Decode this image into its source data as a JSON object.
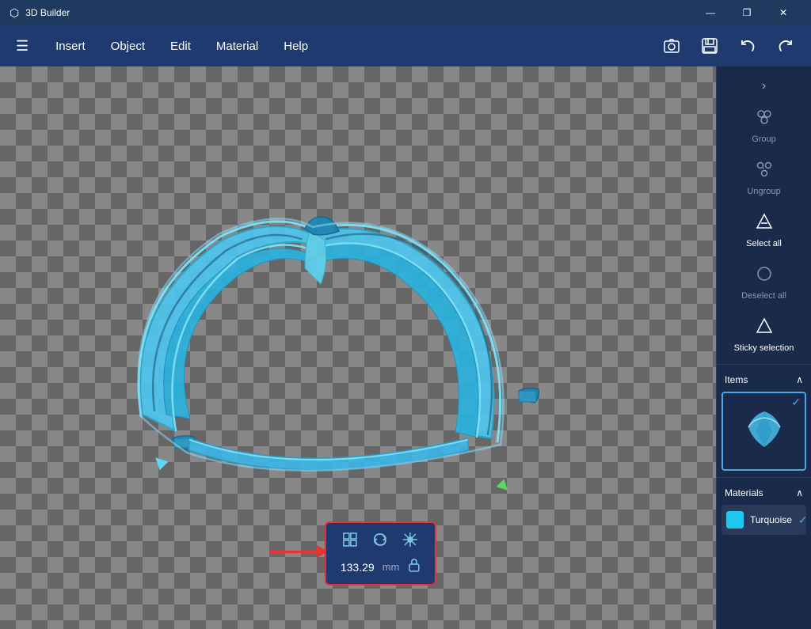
{
  "titleBar": {
    "appName": "3D Builder",
    "controls": {
      "minimize": "—",
      "restore": "❐",
      "close": "✕"
    }
  },
  "menuBar": {
    "hamburgerIcon": "☰",
    "items": [
      "Insert",
      "Object",
      "Edit",
      "Material",
      "Help"
    ],
    "toolbar": {
      "screenshotIcon": "📷",
      "saveIcon": "💾",
      "undoIcon": "↩",
      "redoIcon": "↪"
    }
  },
  "rightPanel": {
    "chevronLabel": "›",
    "items": [
      {
        "id": "group",
        "label": "Group",
        "icon": "⬡"
      },
      {
        "id": "ungroup",
        "label": "Ungroup",
        "icon": "⬡"
      },
      {
        "id": "select-all",
        "label": "Select all",
        "icon": "△"
      },
      {
        "id": "deselect-all",
        "label": "Deselect all",
        "icon": "○"
      },
      {
        "id": "sticky-selection",
        "label": "Sticky selection",
        "icon": "△"
      }
    ],
    "sections": {
      "items": {
        "label": "Items",
        "collapseIcon": "∧"
      },
      "materials": {
        "label": "Materials",
        "collapseIcon": "∧",
        "items": [
          {
            "name": "Turquoise",
            "color": "#1ac8f0"
          }
        ]
      }
    }
  },
  "bottomToolbar": {
    "icons": {
      "resize": "⊞",
      "rotate": "↻",
      "transform": "✥"
    },
    "value": "133.29",
    "unit": "mm",
    "lockIcon": "🔒"
  },
  "viewport": {
    "backgroundColor": "#777"
  }
}
